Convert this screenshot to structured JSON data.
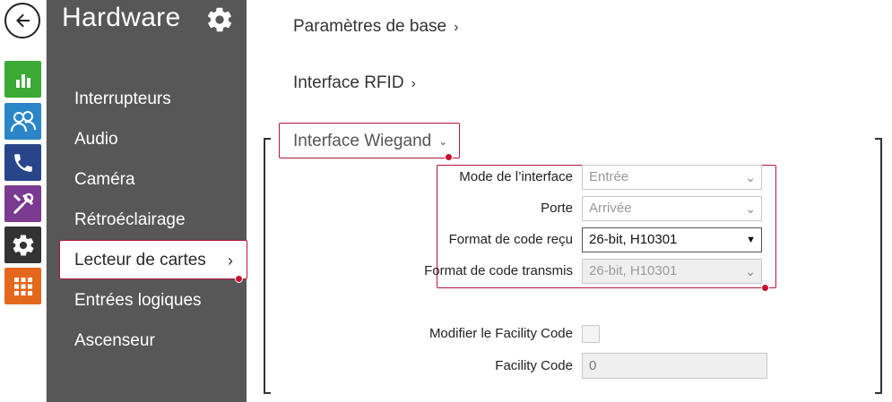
{
  "sidebar": {
    "title": "Hardware",
    "items": [
      {
        "label": "Interrupteurs"
      },
      {
        "label": "Audio"
      },
      {
        "label": "Caméra"
      },
      {
        "label": "Rétroéclairage"
      },
      {
        "label": "Lecteur de cartes",
        "active": true
      },
      {
        "label": "Entrées logiques"
      },
      {
        "label": "Ascenseur"
      }
    ]
  },
  "rail": {
    "icons": [
      "back-arrow-icon",
      "stats-icon",
      "users-icon",
      "phone-icon",
      "tools-icon",
      "gear-icon",
      "grid-icon"
    ]
  },
  "main": {
    "sections": [
      {
        "label": "Paramètres de base"
      },
      {
        "label": "Interface RFID"
      },
      {
        "label": "Interface Wiegand",
        "expanded": true
      }
    ],
    "fields": {
      "interface_mode": {
        "label": "Mode de l’interface",
        "value": "Entrée"
      },
      "door": {
        "label": "Porte",
        "value": "Arrivée"
      },
      "received_format": {
        "label": "Format de code reçu",
        "value": "26-bit, H10301"
      },
      "transmitted_format": {
        "label": "Format de code transmis",
        "value": "26-bit, H10301"
      },
      "modify_facility": {
        "label": "Modifier le Facility Code",
        "checked": false
      },
      "facility_code": {
        "label": "Facility Code",
        "value": "0"
      }
    }
  },
  "colors": {
    "sidebar_bg": "#575757",
    "highlight": "#b3173a",
    "stats": "#3aa935",
    "users": "#2b86c8",
    "phone": "#29458a",
    "tools": "#7a3a8f",
    "gear": "#333333",
    "grid": "#e4681c"
  }
}
